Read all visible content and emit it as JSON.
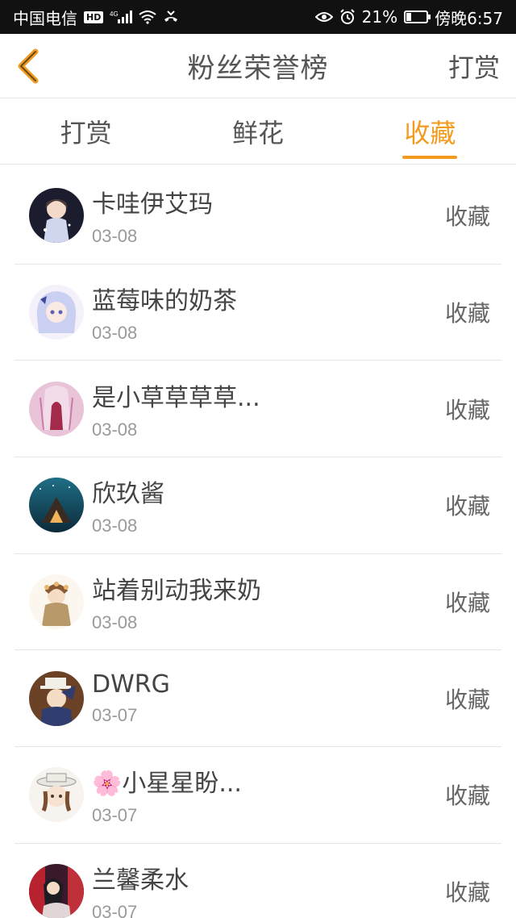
{
  "status": {
    "carrier": "中国电信",
    "hd": "HD",
    "signal": "4G",
    "battery": "21%",
    "time": "傍晚6:57"
  },
  "nav": {
    "title": "粉丝荣誉榜",
    "action": "打赏"
  },
  "tabs": [
    {
      "label": "打赏"
    },
    {
      "label": "鲜花"
    },
    {
      "label": "收藏"
    }
  ],
  "rows": [
    {
      "name": "卡哇伊艾玛",
      "date": "03-08",
      "tag": "收藏"
    },
    {
      "name": "蓝莓味的奶茶",
      "date": "03-08",
      "tag": "收藏"
    },
    {
      "name": "是小草草草草...",
      "date": "03-08",
      "tag": "收藏"
    },
    {
      "name": "欣玖酱",
      "date": "03-08",
      "tag": "收藏"
    },
    {
      "name": "站着别动我来奶",
      "date": "03-08",
      "tag": "收藏"
    },
    {
      "name": "DWRG",
      "date": "03-07",
      "tag": "收藏"
    },
    {
      "name": "🌸小星星盼...",
      "date": "03-07",
      "tag": "收藏"
    },
    {
      "name": "兰馨柔水",
      "date": "03-07",
      "tag": "收藏"
    }
  ],
  "colors": {
    "accent": "#f29b1f",
    "status_bg": "#111111"
  }
}
